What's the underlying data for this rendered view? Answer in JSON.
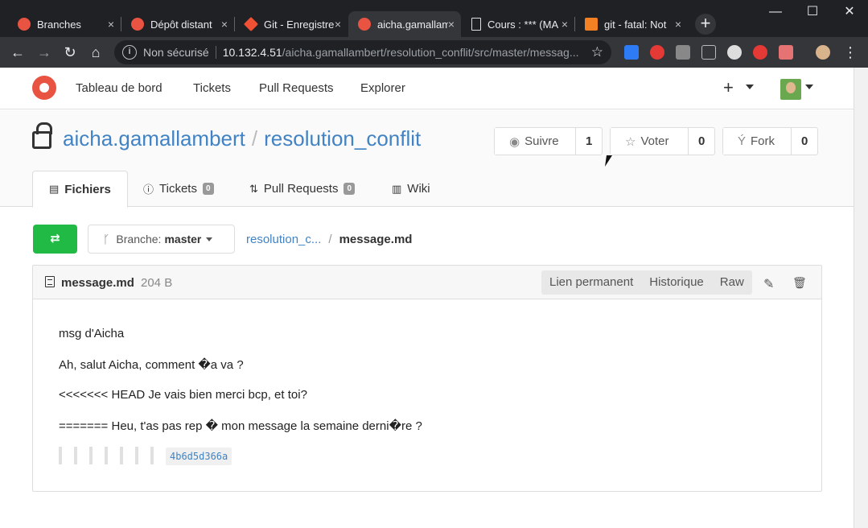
{
  "browser": {
    "tabs": [
      {
        "title": "Branches",
        "favicon_color": "#e85342"
      },
      {
        "title": "Dépôt distant",
        "favicon_color": "#e85342"
      },
      {
        "title": "Git - Enregistrer",
        "favicon_color": "#f05033"
      },
      {
        "title": "aicha.gamallambert",
        "favicon_color": "#e85342"
      },
      {
        "title": "Cours : *** (MAJ",
        "favicon_color": "#dddddd"
      },
      {
        "title": "git - fatal: Not",
        "favicon_color": "#f48024"
      }
    ],
    "close_glyph": "×",
    "new_tab_glyph": "+",
    "window_controls": {
      "minimize": "—",
      "maximize": "☐",
      "close": "✕"
    },
    "nav": {
      "back": "←",
      "forward": "→",
      "reload": "↻",
      "home": "⌂"
    },
    "address": {
      "info_glyph": "i",
      "insecure_label": "Non sécurisé",
      "host": "10.132.4.51",
      "path": "/aicha.gamallambert/resolution_conflit/src/master/messag...",
      "star_glyph": "☆"
    },
    "menu_glyph": "⋮",
    "extension_colors": [
      "#2d7cf6",
      "#e53935",
      "#888888",
      "#bbbbbb",
      "#dddddd",
      "#e53935",
      "#e57373"
    ]
  },
  "gitea": {
    "nav": {
      "items": [
        "Tableau de bord",
        "Tickets",
        "Pull Requests",
        "Explorer"
      ],
      "plus_glyph": "+"
    },
    "repo": {
      "owner": "aicha.gamallambert",
      "separator": "/",
      "name": "resolution_conflit",
      "watch": {
        "icon": "◉",
        "label": "Suivre",
        "count": "1"
      },
      "star": {
        "icon": "☆",
        "label": "Voter",
        "count": "0"
      },
      "fork": {
        "icon": "Ý",
        "label": "Fork",
        "count": "0"
      }
    },
    "tabs": [
      {
        "icon": "▤",
        "label": "Fichiers"
      },
      {
        "icon": "ⓘ",
        "label": "Tickets",
        "badge": "0"
      },
      {
        "icon": "⇅",
        "label": "Pull Requests",
        "badge": "0"
      },
      {
        "icon": "▥",
        "label": "Wiki"
      }
    ],
    "compare_glyph": "⇄",
    "branch": {
      "icon": "ᚴ",
      "prefix": "Branche:",
      "value": "master"
    },
    "breadcrumb": {
      "repo": "resolution_c...",
      "separator": "/",
      "file": "message.md"
    },
    "file": {
      "name": "message.md",
      "size": "204 B",
      "actions": [
        "Lien permanent",
        "Historique",
        "Raw"
      ],
      "edit_glyph": "✎",
      "delete_glyph": "🗑",
      "lines": [
        "msg d'Aicha",
        "Ah, salut Aicha, comment �a va ?",
        "<<<<<<< HEAD Je vais bien merci bcp, et toi?",
        "======= Heu, t'as pas rep � mon message la semaine derni�re ?"
      ],
      "commit_hash": "4b6d5d366a"
    }
  }
}
